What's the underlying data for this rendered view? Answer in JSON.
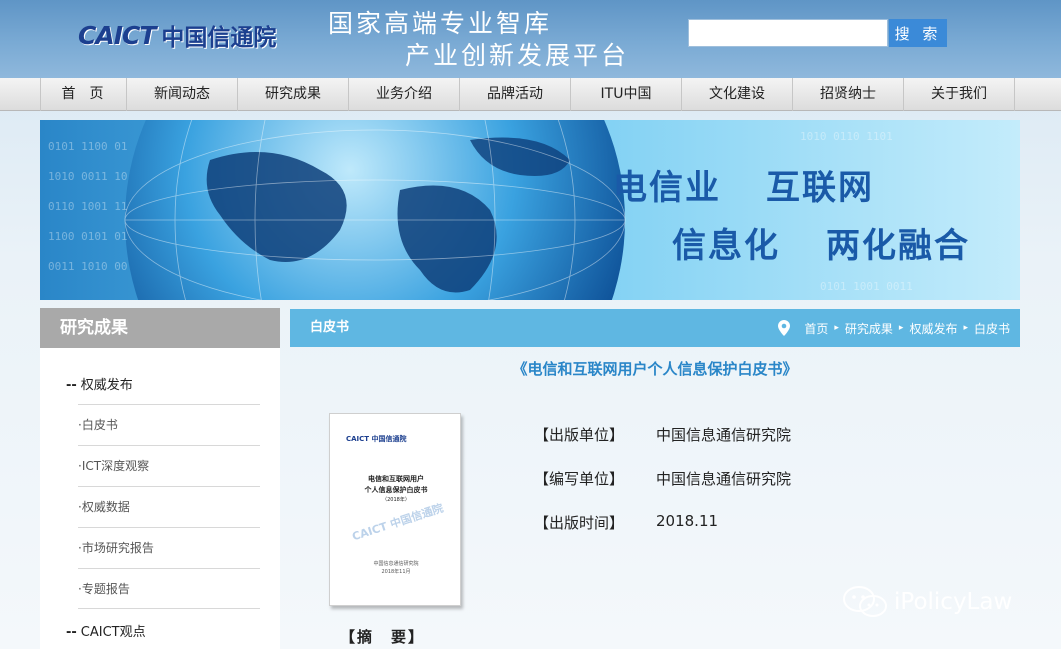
{
  "header": {
    "logo_mark": "CAICT",
    "logo_text": "中国信通院",
    "slogan_line1": "国家高端专业智库",
    "slogan_line2": "产业创新发展平台",
    "search_value": "",
    "search_button": "搜 索"
  },
  "nav": {
    "items": [
      "首页",
      "新闻动态",
      "研究成果",
      "业务介绍",
      "品牌活动",
      "ITU中国",
      "文化建设",
      "招贤纳士",
      "关于我们"
    ]
  },
  "banner": {
    "line1_left": "电信业",
    "line1_right": "互联网",
    "line2_left": "信息化",
    "line2_right": "两化融合"
  },
  "sidebar": {
    "title": "研究成果",
    "category1": "权威发布",
    "subitems": [
      "白皮书",
      "ICT深度观察",
      "权威数据",
      "市场研究报告",
      "专题报告"
    ],
    "category2": "CAICT观点",
    "bullet": "·",
    "dash": "--"
  },
  "main": {
    "section_title": "白皮书",
    "breadcrumb": [
      "首页",
      "研究成果",
      "权威发布",
      "白皮书"
    ],
    "doc_title": "《电信和互联网用户个人信息保护白皮书》",
    "info": [
      {
        "label": "【出版单位】",
        "value": "中国信息通信研究院"
      },
      {
        "label": "【编写单位】",
        "value": "中国信息通信研究院"
      },
      {
        "label": "【出版时间】",
        "value": "2018.11"
      }
    ],
    "abstract_label": "【摘　要】"
  },
  "cover": {
    "logo": "CAICT 中国信通院",
    "title_line1": "电信和互联网用户",
    "title_line2": "个人信息保护白皮书",
    "year": "（2018年）",
    "watermark": "CAICT 中国信通院",
    "footer_org": "中国信息通信研究院",
    "footer_date": "2018年11月"
  },
  "watermark": {
    "text": "iPolicyLaw"
  }
}
